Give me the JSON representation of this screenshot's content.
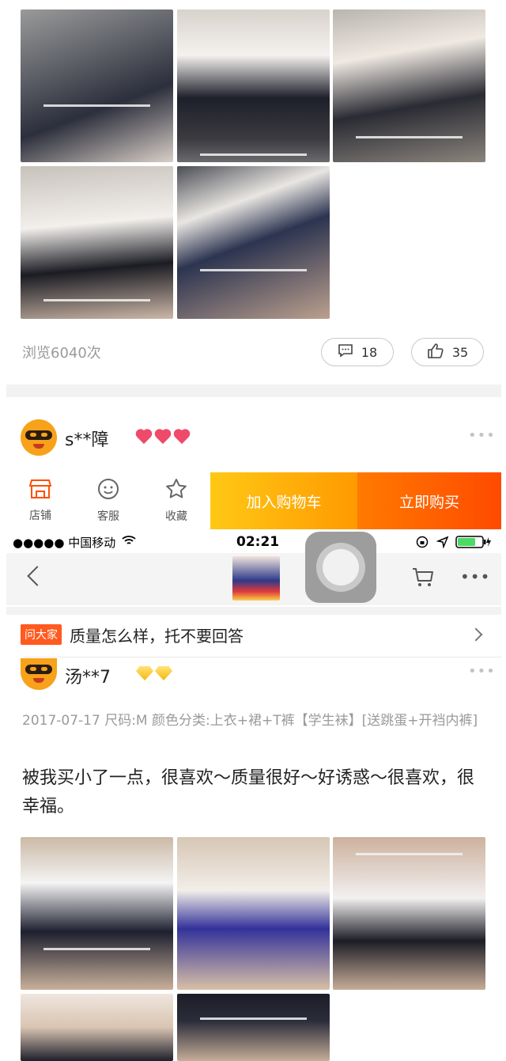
{
  "post_top": {
    "views_text": "浏览6040次",
    "comment_count": "18",
    "like_count": "35"
  },
  "reviewer1": {
    "name": "s**障",
    "level_icon": "heart-icon"
  },
  "action_bar": {
    "shop_label": "店铺",
    "service_label": "客服",
    "favorite_label": "收藏",
    "add_cart_label": "加入购物车",
    "buy_now_label": "立即购买",
    "add_cart_color": "#ffb20a",
    "buy_now_color": "#ff5a00"
  },
  "status_bar": {
    "carrier": "●●●●● 中国移动",
    "time": "02:21"
  },
  "ask_bar": {
    "tag": "问大家",
    "question": "质量怎么样，托不要回答"
  },
  "reviewer2": {
    "name": "汤**7",
    "level_icon": "diamond-icon",
    "meta": "2017-07-17  尺码:M  颜色分类:上衣+裙+T裤【学生袜】[送跳蛋+开裆内裤]",
    "text": "被我买小了一点，很喜欢～质量很好～好诱惑～很喜欢，很幸福。"
  }
}
